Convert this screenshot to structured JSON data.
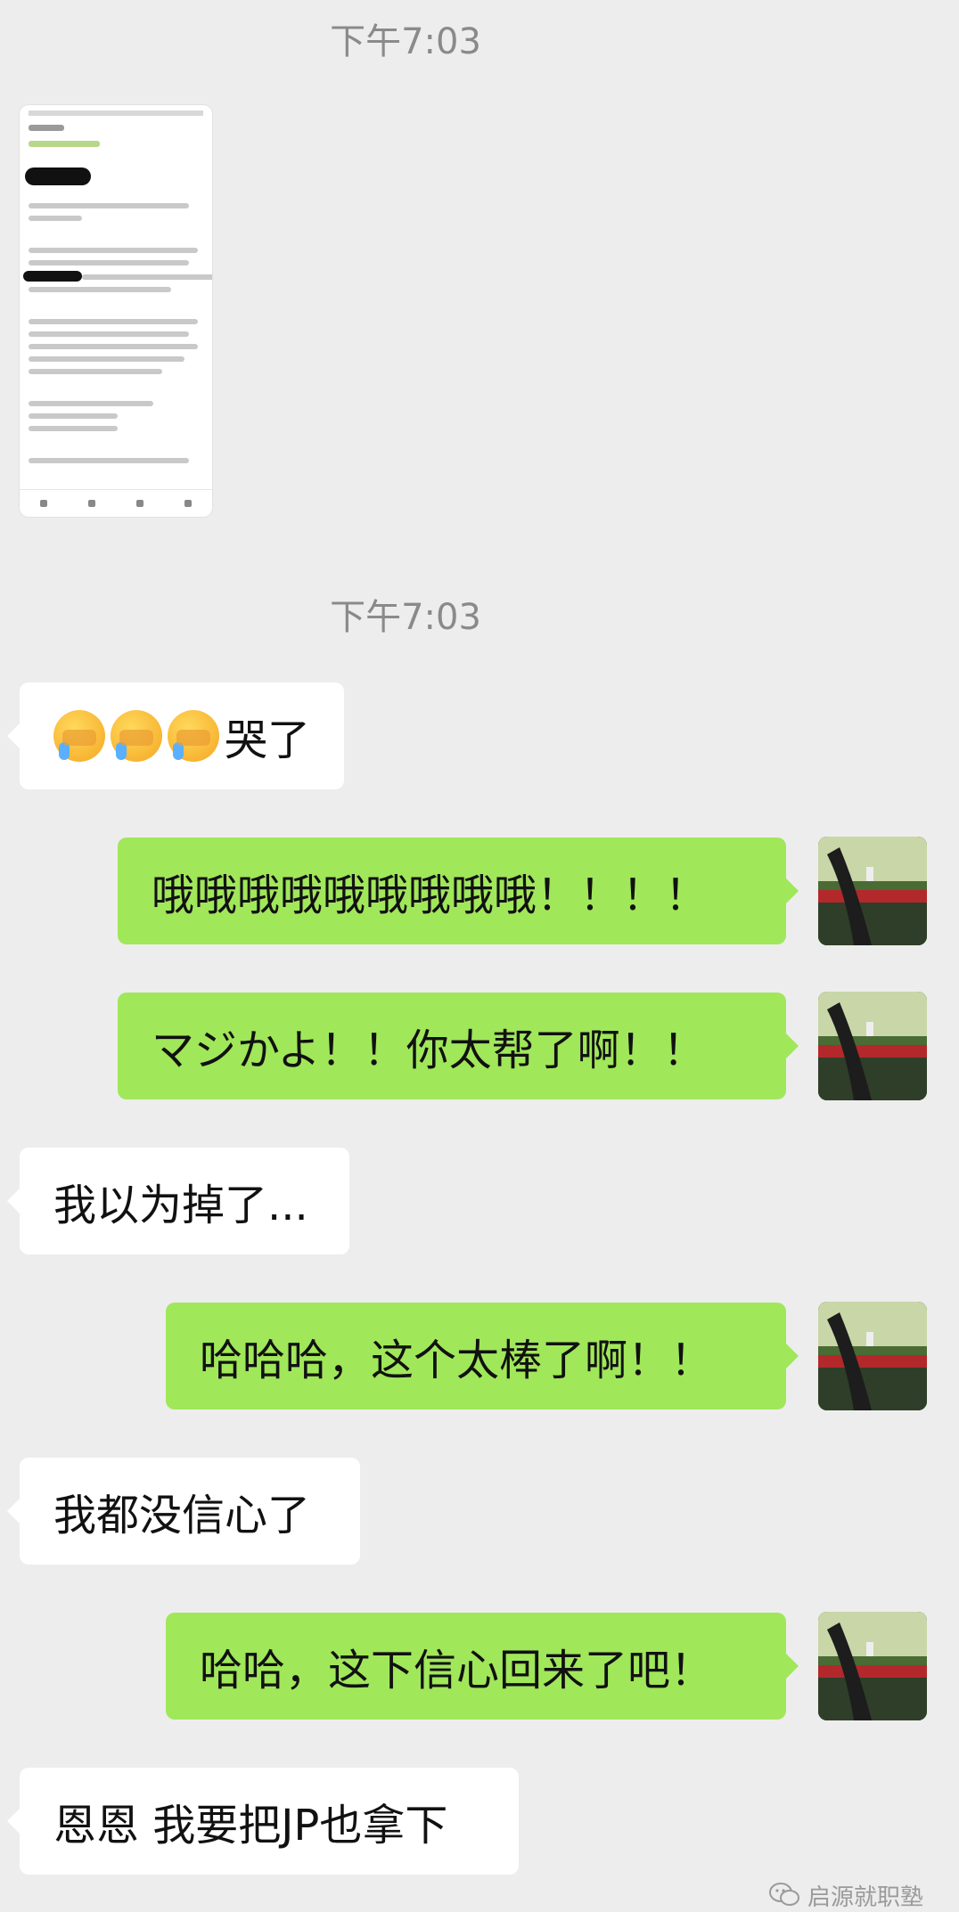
{
  "chat": {
    "timestamps": [
      "下午7:03",
      "下午7:03"
    ],
    "messages": [
      {
        "side": "left",
        "text": "哭了",
        "emoji_count": 3
      },
      {
        "side": "right",
        "text": "哦哦哦哦哦哦哦哦哦！！！！"
      },
      {
        "side": "right",
        "text": "マジかよ！！你太帮了啊！！"
      },
      {
        "side": "left",
        "text": "我以为掉了..."
      },
      {
        "side": "right",
        "text": "哈哈哈，这个太棒了啊！！"
      },
      {
        "side": "left",
        "text": "我都没信心了"
      },
      {
        "side": "right",
        "text": "哈哈，这下信心回来了吧！"
      },
      {
        "side": "left",
        "text": "恩恩 我要把JP也拿下"
      }
    ]
  },
  "emoji_name": "crying-face-emoji",
  "watermark": {
    "text": "启源就职塾",
    "icon": "wechat-icon"
  },
  "colors": {
    "background": "#ededed",
    "incoming": "#ffffff",
    "outgoing": "#a0e75a",
    "timestamp": "#8a8a8a"
  }
}
